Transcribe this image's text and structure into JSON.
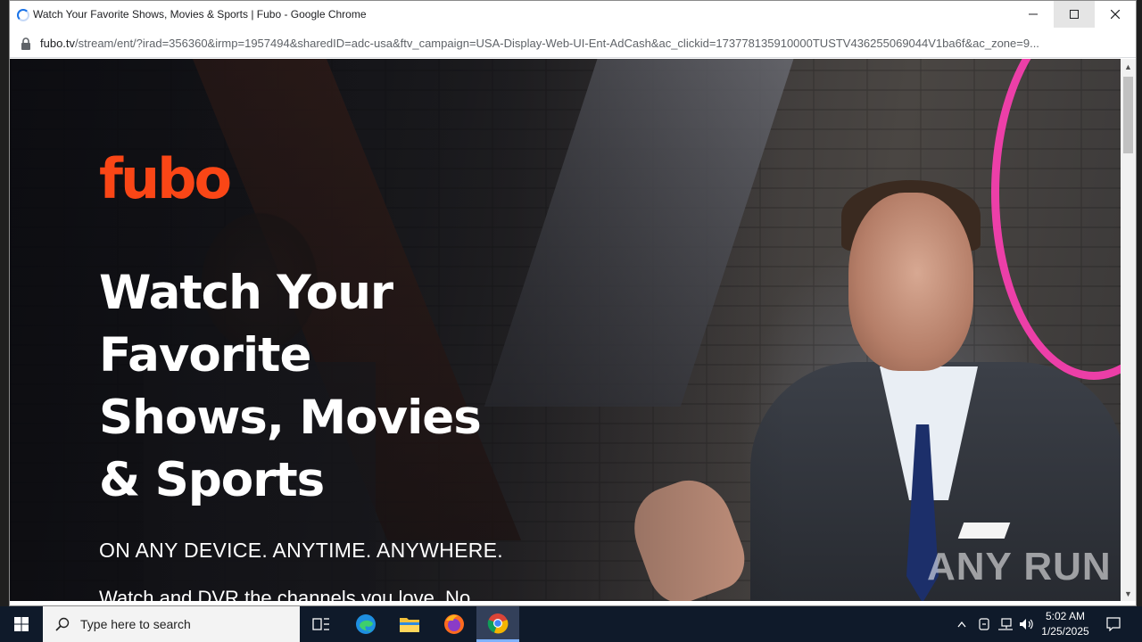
{
  "window": {
    "title": "Watch Your Favorite Shows, Movies & Sports | Fubo - Google Chrome",
    "url_host": "fubo.tv",
    "url_path": "/stream/ent/?irad=356360&irmp=1957494&sharedID=adc-usa&ftv_campaign=USA-Display-Web-UI-Ent-AdCash&ac_clickid=173778135910000TUSTV436255069044V1ba6f&ac_zone=9..."
  },
  "page": {
    "logo": "fubo",
    "headline": [
      "Watch Your",
      "Favorite",
      "Shows, Movies",
      "& Sports"
    ],
    "tagline": "ON ANY DEVICE. ANYTIME. ANYWHERE.",
    "subtext": "Watch and DVR the channels you love. No",
    "watermark": "ANY RUN",
    "accent_color": "#fa4616"
  },
  "taskbar": {
    "search_placeholder": "Type here to search",
    "time": "5:02 AM",
    "date": "1/25/2025",
    "apps": [
      "task-view",
      "edge",
      "file-explorer",
      "firefox",
      "chrome"
    ]
  }
}
